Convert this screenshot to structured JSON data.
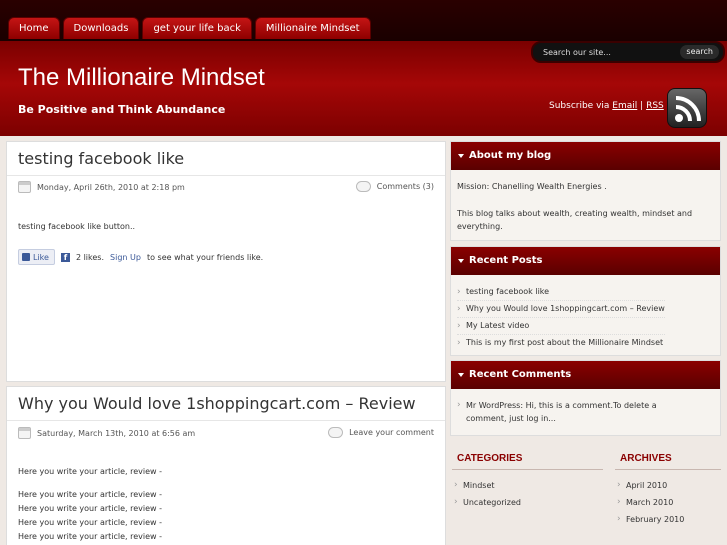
{
  "nav": {
    "items": [
      "Home",
      "Downloads",
      "get your life back",
      "Millionaire Mindset"
    ]
  },
  "header": {
    "site_title": "The Millionaire Mindset",
    "tagline": "Be Positive and Think Abundance",
    "search_placeholder": "Search our site...",
    "search_button": "search",
    "subscribe_prefix": "Subscribe via",
    "subscribe_email": "Email",
    "subscribe_sep": "|",
    "subscribe_rss": "RSS"
  },
  "posts": [
    {
      "title": "testing facebook like",
      "date": "Monday, April 26th, 2010 at 2:18 pm",
      "comments": "Comments (3)",
      "body": "testing facebook like button..",
      "like_label": "Like",
      "like_text": "2 likes.",
      "signup": "Sign Up",
      "like_suffix": "to see what your friends like."
    },
    {
      "title": "Why you Would love 1shoppingcart.com – Review",
      "date": "Saturday, March 13th, 2010 at 6:56 am",
      "comments": "Leave your comment",
      "lines": [
        "Here you write your article, review -",
        "Here you write your article, review -",
        "Here you write your article, review -",
        "Here you write your article, review -",
        "Here you write your article, review -"
      ]
    }
  ],
  "sidebar": {
    "about": {
      "title": "About my blog",
      "text1": "Mission: Chanelling Wealth Energies .",
      "text2": "This blog talks about wealth, creating wealth, mindset and",
      "text3": "everything."
    },
    "recent_posts": {
      "title": "Recent Posts",
      "items": [
        "testing facebook like",
        "Why you Would love 1shoppingcart.com – Review",
        "My Latest video",
        "This is my first post about the Millionaire Mindset"
      ]
    },
    "recent_comments": {
      "title": "Recent Comments",
      "line1": "Mr WordPress: Hi, this is a comment.To delete a",
      "line2": "comment, just log in..."
    },
    "categories": {
      "title": "CATEGORIES",
      "items": [
        "Mindset",
        "Uncategorized"
      ]
    },
    "archives": {
      "title": "ARCHIVES",
      "items": [
        "April 2010",
        "March 2010",
        "February 2010"
      ]
    }
  }
}
